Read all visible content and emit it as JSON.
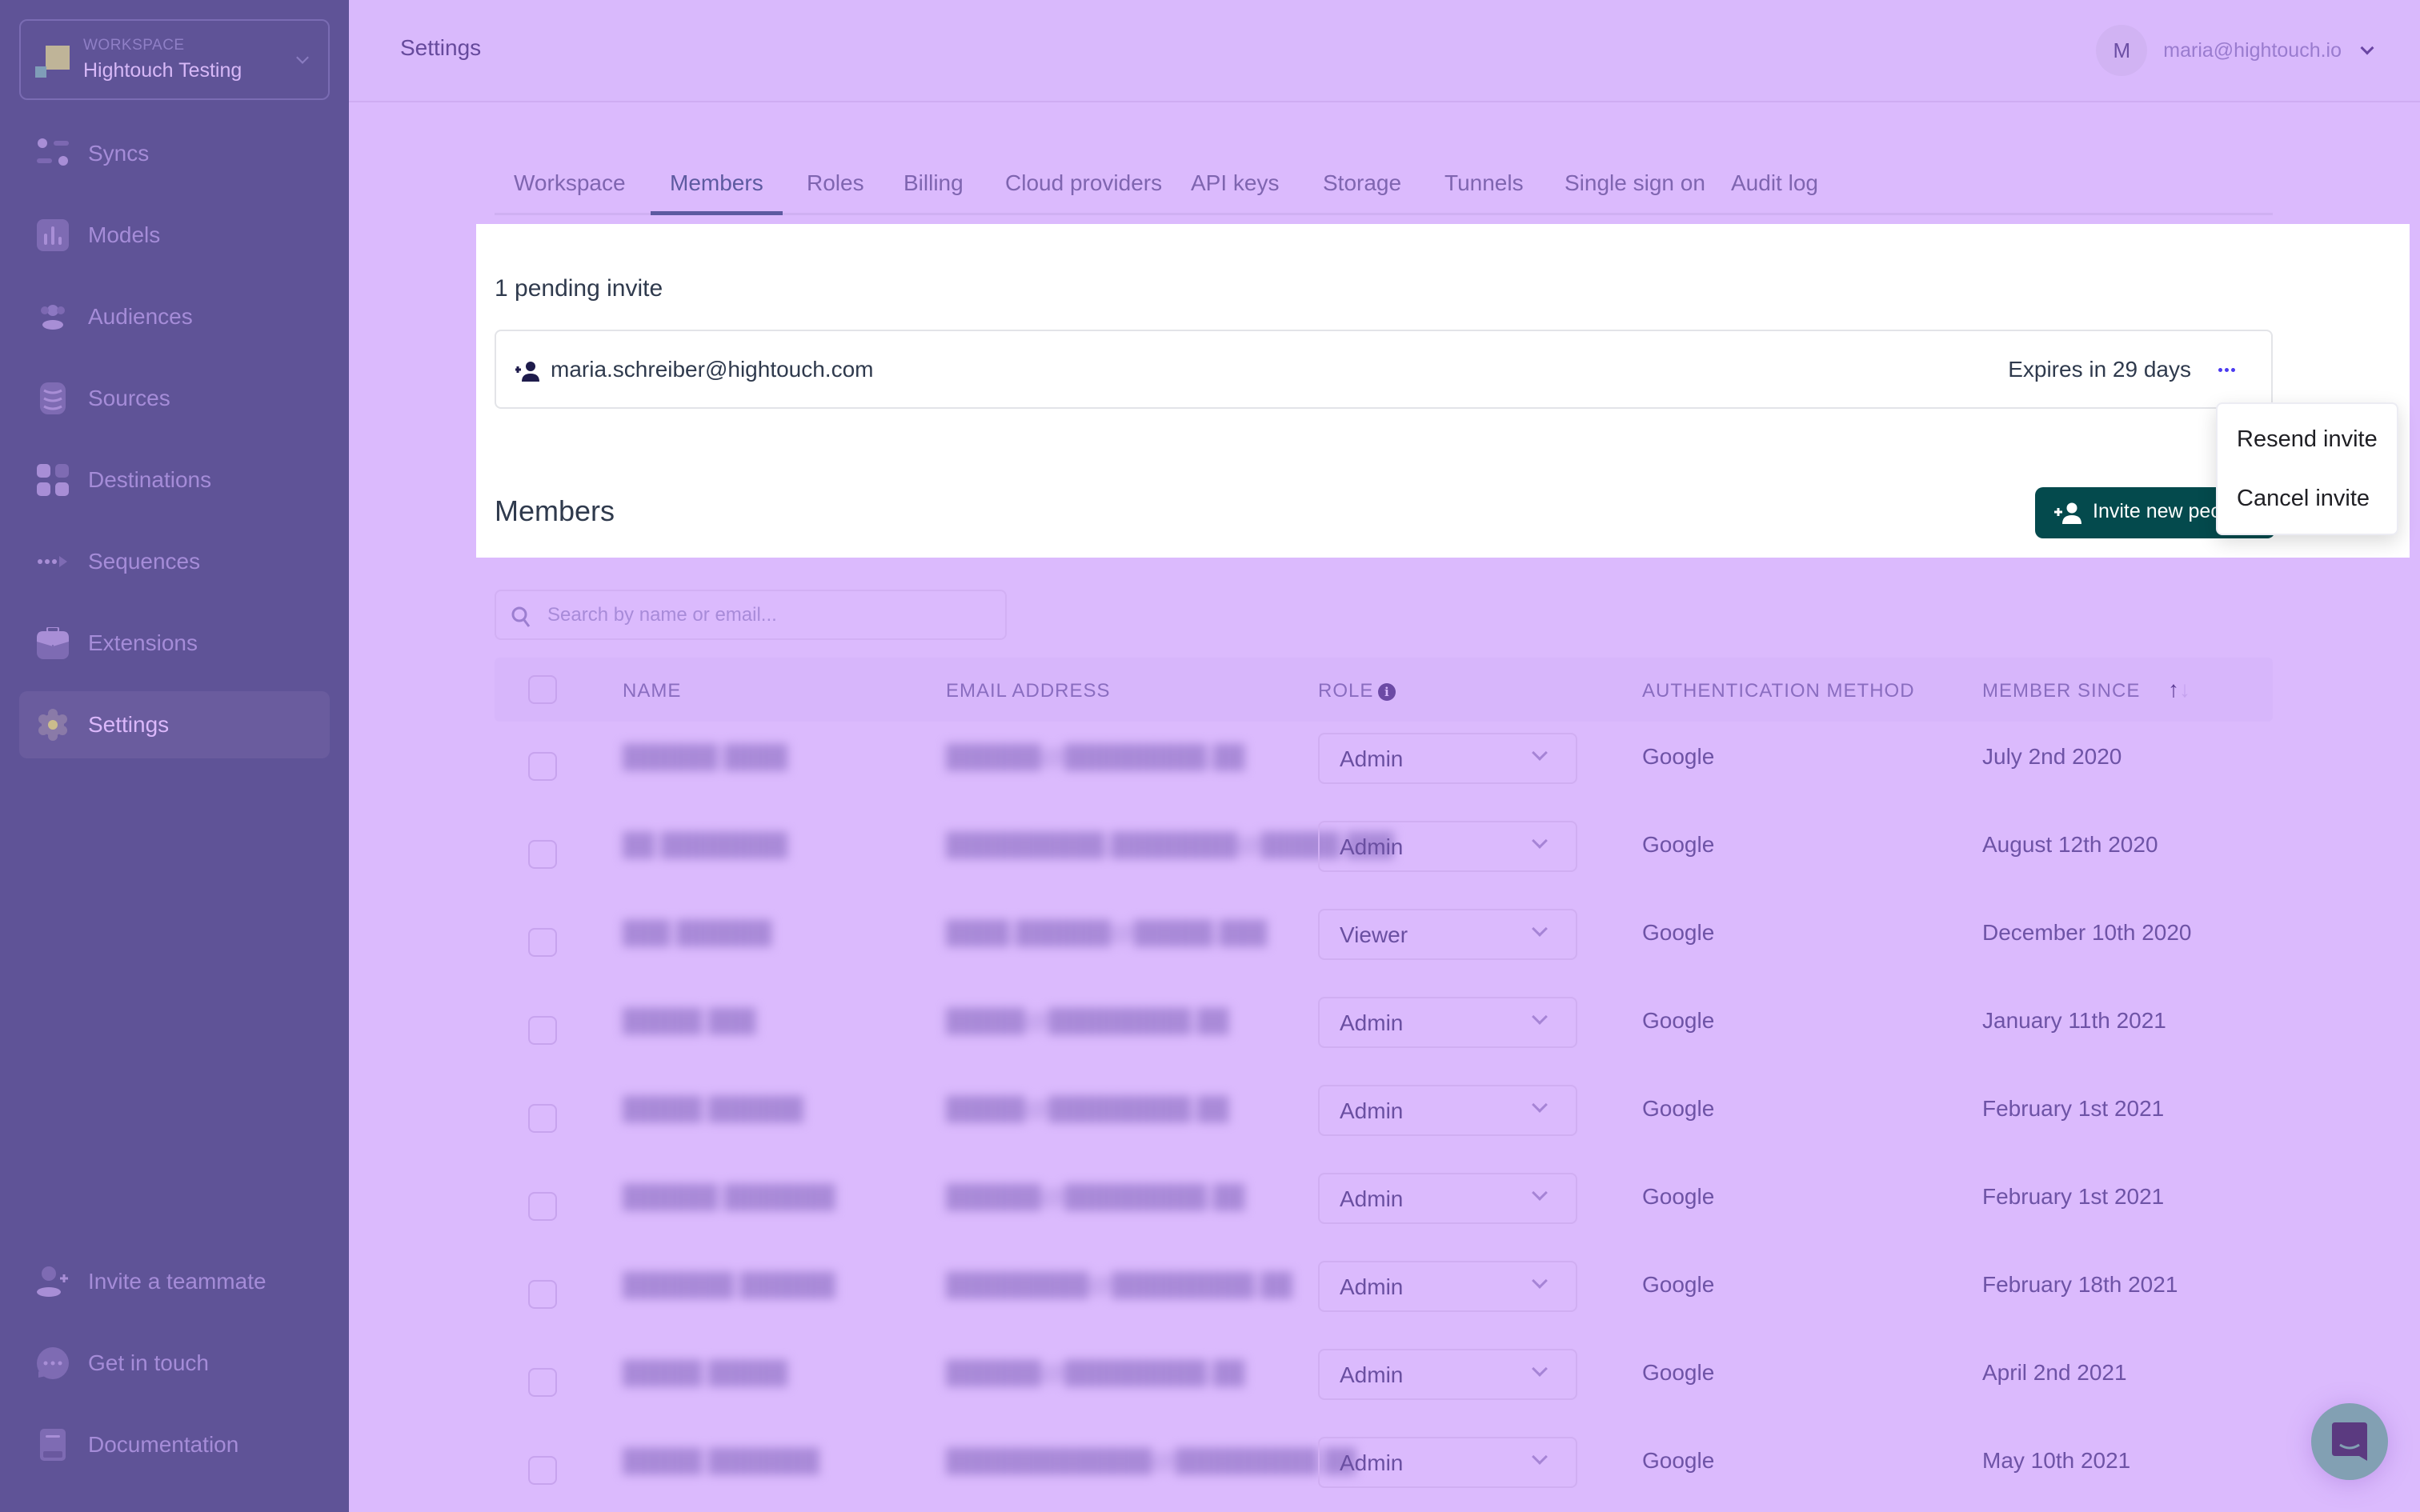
{
  "workspace": {
    "label": "WORKSPACE",
    "name": "Hightouch Testing"
  },
  "sidebar": {
    "items": [
      {
        "label": "Syncs",
        "icon": "syncs-icon"
      },
      {
        "label": "Models",
        "icon": "bar-chart-icon"
      },
      {
        "label": "Audiences",
        "icon": "people-icon"
      },
      {
        "label": "Sources",
        "icon": "database-icon"
      },
      {
        "label": "Destinations",
        "icon": "grid-icon"
      },
      {
        "label": "Sequences",
        "icon": "sequence-arrow-icon"
      },
      {
        "label": "Extensions",
        "icon": "briefcase-icon"
      },
      {
        "label": "Settings",
        "icon": "gear-icon",
        "active": true
      }
    ],
    "footer": [
      {
        "label": "Invite a teammate",
        "icon": "user-plus-icon"
      },
      {
        "label": "Get in touch",
        "icon": "chat-bubble-icon"
      },
      {
        "label": "Documentation",
        "icon": "book-icon"
      }
    ]
  },
  "header": {
    "title": "Settings",
    "user": {
      "initial": "M",
      "email": "maria@hightouch.io"
    }
  },
  "tabs": [
    {
      "label": "Workspace"
    },
    {
      "label": "Members",
      "active": true
    },
    {
      "label": "Roles"
    },
    {
      "label": "Billing"
    },
    {
      "label": "Cloud providers"
    },
    {
      "label": "API keys"
    },
    {
      "label": "Storage"
    },
    {
      "label": "Tunnels"
    },
    {
      "label": "Single sign on"
    },
    {
      "label": "Audit log"
    }
  ],
  "pending": {
    "title": "1 pending invite",
    "invites": [
      {
        "email": "maria.schreiber@hightouch.com",
        "expiry": "Expires in 29 days"
      }
    ],
    "menu": {
      "items": [
        "Resend invite",
        "Cancel invite"
      ]
    }
  },
  "members": {
    "title": "Members",
    "invite_button": "Invite new people",
    "search_placeholder": "Search by name or email...",
    "columns": {
      "name": "NAME",
      "email": "EMAIL ADDRESS",
      "role": "ROLE",
      "auth": "AUTHENTICATION METHOD",
      "since": "MEMBER SINCE"
    },
    "sort": {
      "column": "since",
      "direction": "ascending"
    },
    "rows": [
      {
        "name": "██████ ████",
        "email": "██████@█████████.██",
        "role": "Admin",
        "auth": "Google",
        "since": "July 2nd 2020"
      },
      {
        "name": "██ ████████",
        "email": "██████████.████████@█████.███",
        "role": "Admin",
        "auth": "Google",
        "since": "August 12th 2020"
      },
      {
        "name": "███ ██████",
        "email": "████.██████@█████.███",
        "role": "Viewer",
        "auth": "Google",
        "since": "December 10th 2020"
      },
      {
        "name": "█████ ███",
        "email": "█████@█████████.██",
        "role": "Admin",
        "auth": "Google",
        "since": "January 11th 2021"
      },
      {
        "name": "█████ ██████",
        "email": "█████@█████████.██",
        "role": "Admin",
        "auth": "Google",
        "since": "February 1st 2021"
      },
      {
        "name": "██████ ███████",
        "email": "██████@█████████.██",
        "role": "Admin",
        "auth": "Google",
        "since": "February 1st 2021"
      },
      {
        "name": "███████ ██████",
        "email": "█████████@█████████.██",
        "role": "Admin",
        "auth": "Google",
        "since": "February 18th 2021"
      },
      {
        "name": "█████ █████",
        "email": "██████@█████████.██",
        "role": "Admin",
        "auth": "Google",
        "since": "April 2nd 2021"
      },
      {
        "name": "█████ ███████",
        "email": "█████████████@█████████.██",
        "role": "Admin",
        "auth": "Google",
        "since": "May 10th 2021"
      }
    ]
  },
  "colors": {
    "sidebar_bg": "#5f5397",
    "page_bg": "#dbbafd",
    "primary_button": "#044a4d",
    "more_dots": "#4a3af0"
  }
}
